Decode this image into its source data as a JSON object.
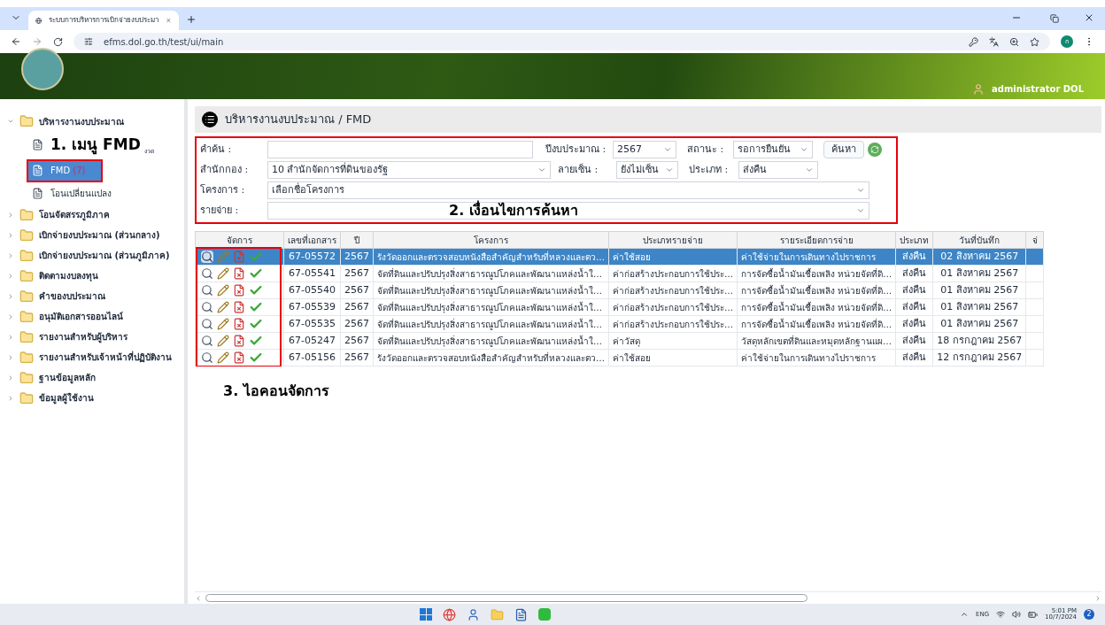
{
  "browser": {
    "tab_title": "ระบบการบริหารการเบิกจ่ายงบประมา",
    "url": "efms.dol.go.th/test/ui/main",
    "profile_initial": "ก"
  },
  "header": {
    "user": "administrator DOL"
  },
  "sidebar": {
    "items": [
      {
        "label": "บริหารงานงบประมาณ",
        "expanded": true,
        "children": [
          {
            "label": "งวด",
            "selected": false,
            "annotation": "1. เมนู FMD"
          },
          {
            "label": "FMD",
            "count": "(7)",
            "selected": true
          },
          {
            "label": "โอนเปลี่ยนแปลง",
            "selected": false
          }
        ]
      },
      {
        "label": "โอนจัดสรรภูมิภาค",
        "expanded": false
      },
      {
        "label": "เบิกจ่ายงบประมาณ (ส่วนกลาง)",
        "expanded": false
      },
      {
        "label": "เบิกจ่ายงบประมาณ (ส่วนภูมิภาค)",
        "expanded": false
      },
      {
        "label": "ติดตามงบลงทุน",
        "expanded": false
      },
      {
        "label": "คำของบประมาณ",
        "expanded": false
      },
      {
        "label": "อนุมัติเอกสารออนไลน์",
        "expanded": false
      },
      {
        "label": "รายงานสำหรับผู้บริหาร",
        "expanded": false
      },
      {
        "label": "รายงานสำหรับเจ้าหน้าที่ปฏิบัติงาน",
        "expanded": false
      },
      {
        "label": "ฐานข้อมูลหลัก",
        "expanded": false
      },
      {
        "label": "ข้อมูลผู้ใช้งาน",
        "expanded": false
      }
    ]
  },
  "page_title": "บริหารงานงบประมาณ / FMD",
  "filters": {
    "keyword": {
      "label": "คำค้น :"
    },
    "fiscal_year": {
      "label": "ปีงบประมาณ :",
      "value": "2567"
    },
    "status": {
      "label": "สถานะ :",
      "value": "รอการยืนยัน"
    },
    "search_button": "ค้นหา",
    "division": {
      "label": "สำนักกอง :",
      "value": "10 สำนักจัดการที่ดินของรัฐ"
    },
    "signature": {
      "label": "ลายเซ็น :",
      "value": "ยังไม่เซ็น"
    },
    "type": {
      "label": "ประเภท :",
      "value": "ส่งคืน"
    },
    "project": {
      "label": "โครงการ :",
      "placeholder": "เลือกชื่อโครงการ"
    },
    "expense": {
      "label": "รายจ่าย :"
    },
    "annotation": "2. เงื่อนไขการค้นหา"
  },
  "table": {
    "columns": [
      "จัดการ",
      "เลขที่เอกสาร",
      "ปี",
      "โครงการ",
      "ประเภทรายจ่าย",
      "รายระเอียดการจ่าย",
      "ประเภท",
      "วันที่บันทึก",
      "จ่"
    ],
    "rows": [
      {
        "selected": true,
        "cells": [
          "",
          "67-05572",
          "2567",
          "รังวัดออกและตรวจสอบหนังสือสำคัญสำหรับที่หลวงและตว…",
          "ค่าใช้สอย",
          "ค่าใช้จ่ายในการเดินทางไปราชการ",
          "ส่งคืน",
          "02 สิงหาคม 2567"
        ]
      },
      {
        "selected": false,
        "cells": [
          "",
          "67-05541",
          "2567",
          "จัดที่ดินและปรับปรุงสิ่งสาธารณูปโภคและพัฒนาแหล่งน้ำใ…",
          "ค่าก่อสร้างประกอบการใช้ประ…",
          "การจัดซื้อน้ำมันเชื้อเพลิง หน่วยจัดที่ดิ…",
          "ส่งคืน",
          "01 สิงหาคม 2567"
        ]
      },
      {
        "selected": false,
        "cells": [
          "",
          "67-05540",
          "2567",
          "จัดที่ดินและปรับปรุงสิ่งสาธารณูปโภคและพัฒนาแหล่งน้ำใ…",
          "ค่าก่อสร้างประกอบการใช้ประ…",
          "การจัดซื้อน้ำมันเชื้อเพลิง หน่วยจัดที่ดิ…",
          "ส่งคืน",
          "01 สิงหาคม 2567"
        ]
      },
      {
        "selected": false,
        "cells": [
          "",
          "67-05539",
          "2567",
          "จัดที่ดินและปรับปรุงสิ่งสาธารณูปโภคและพัฒนาแหล่งน้ำใ…",
          "ค่าก่อสร้างประกอบการใช้ประ…",
          "การจัดซื้อน้ำมันเชื้อเพลิง หน่วยจัดที่ดิ…",
          "ส่งคืน",
          "01 สิงหาคม 2567"
        ]
      },
      {
        "selected": false,
        "cells": [
          "",
          "67-05535",
          "2567",
          "จัดที่ดินและปรับปรุงสิ่งสาธารณูปโภคและพัฒนาแหล่งน้ำใ…",
          "ค่าก่อสร้างประกอบการใช้ประ…",
          "การจัดซื้อน้ำมันเชื้อเพลิง หน่วยจัดที่ดิ…",
          "ส่งคืน",
          "01 สิงหาคม 2567"
        ]
      },
      {
        "selected": false,
        "cells": [
          "",
          "67-05247",
          "2567",
          "จัดที่ดินและปรับปรุงสิ่งสาธารณูปโภคและพัฒนาแหล่งน้ำใ…",
          "ค่าวัสดุ",
          "วัสดุหลักเขตที่ดินและหมุดหลักฐานแผ…",
          "ส่งคืน",
          "18 กรกฎาคม 2567"
        ]
      },
      {
        "selected": false,
        "cells": [
          "",
          "67-05156",
          "2567",
          "รังวัดออกและตรวจสอบหนังสือสำคัญสำหรับที่หลวงและตว…",
          "ค่าใช้สอย",
          "ค่าใช้จ่ายในการเดินทางไปราชการ",
          "ส่งคืน",
          "12 กรกฎาคม 2567"
        ]
      }
    ],
    "annotation": "3. ไอคอนจัดการ"
  },
  "taskbar": {
    "language": "ENG",
    "time": "5:01 PM",
    "date": "10/7/2024",
    "notifications": "2"
  }
}
